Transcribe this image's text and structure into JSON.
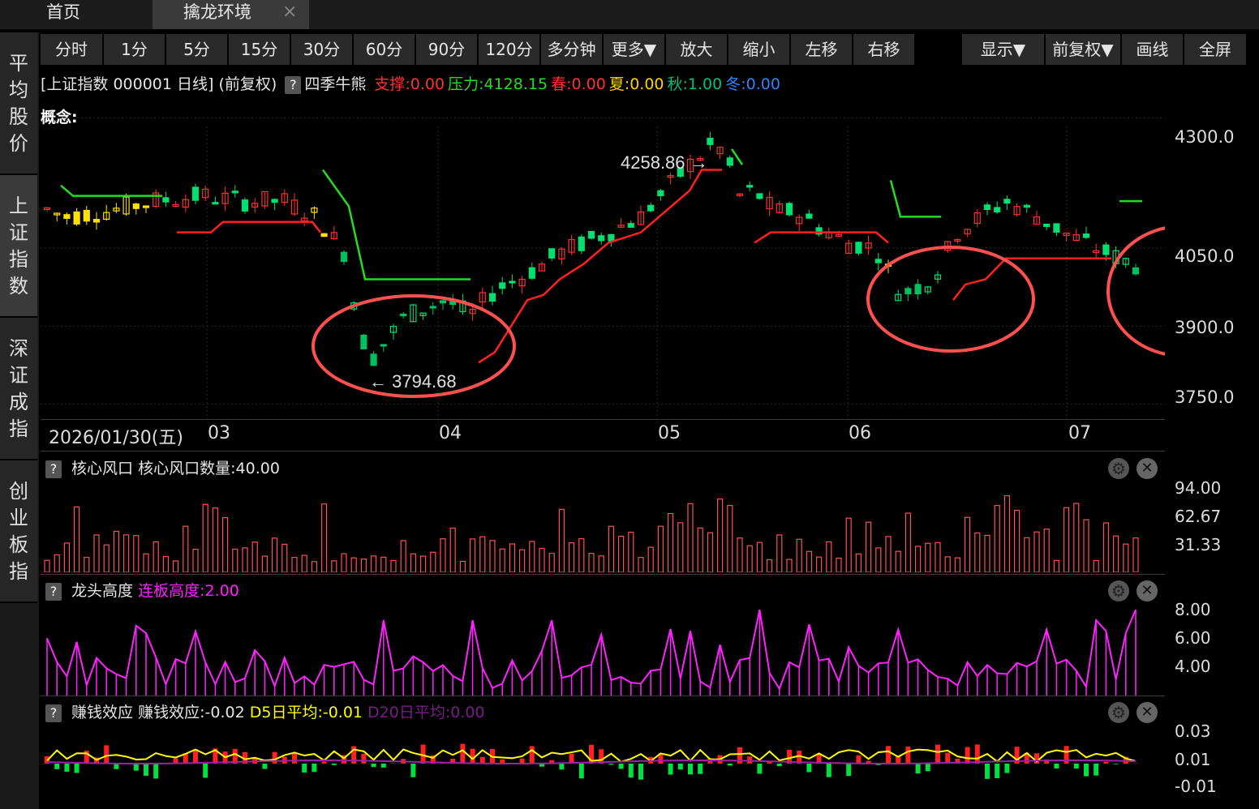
{
  "tabs": {
    "home": "首页",
    "active": "擒龙环境",
    "close": "×"
  },
  "sidebar": [
    {
      "label": "平均股价"
    },
    {
      "label": "上证指数"
    },
    {
      "label": "深证成指"
    },
    {
      "label": "创业板指"
    }
  ],
  "toolbar": [
    "分时",
    "1分",
    "5分",
    "15分",
    "30分",
    "60分",
    "90分",
    "120分",
    "多分钟",
    "更多▼",
    "放大",
    "缩小",
    "左移",
    "右移",
    "显示▼",
    "前复权▼",
    "画线",
    "全屏"
  ],
  "info": {
    "title": "[上证指数 000001 日线] (前复权)",
    "help": "?",
    "indicator": "四季牛熊",
    "support": "支撑:0.00",
    "pressure": "压力:4128.15",
    "spring": "春:0.00",
    "summer": "夏:0.00",
    "autumn": "秋:1.00",
    "winter": "冬:0.00"
  },
  "concept": "概念:",
  "main_chart": {
    "y_ticks": [
      "4300.0",
      "4050.0",
      "3900.0",
      "3750.0"
    ],
    "date_start": "2026/01/30(五)",
    "month_labels": [
      "03",
      "04",
      "05",
      "06",
      "07"
    ],
    "high_label": "4258.86",
    "low_label": "3794.68"
  },
  "panel1": {
    "help": "?",
    "title": "核心风口",
    "value": "核心风口数量:40.00",
    "ticks": [
      "94.00",
      "62.67",
      "31.33"
    ],
    "gear": "⚙",
    "close": "✕"
  },
  "panel2": {
    "help": "?",
    "title": "龙头高度",
    "value": "连板高度:2.00",
    "ticks": [
      "8.00",
      "6.00",
      "4.00"
    ],
    "gear": "⚙",
    "close": "✕"
  },
  "panel3": {
    "help": "?",
    "title": "赚钱效应",
    "value": "赚钱效应:-0.02",
    "d5": "D5日平均:-0.01",
    "d20": "D20日平均:0.00",
    "ticks": [
      "0.03",
      "0.01",
      "-0.01"
    ],
    "gear": "⚙",
    "close": "✕"
  },
  "colors": {
    "up": "#ff3030",
    "down": "#00e070",
    "support": "#ff2020",
    "pressure": "#22dd22",
    "magenta": "#ff22ff",
    "yellow": "#ffff00",
    "circle": "#ff5050"
  },
  "chart_data": {
    "type": "candlestick",
    "x": [
      "2026/01/30",
      "03",
      "04",
      "05",
      "06",
      "07"
    ],
    "ylim": [
      3750,
      4300
    ],
    "annotations": [
      {
        "text": "4258.86",
        "kind": "high"
      },
      {
        "text": "3794.68",
        "kind": "low"
      }
    ],
    "panels": [
      {
        "name": "核心风口数量",
        "type": "bar",
        "ylim": [
          0,
          94
        ]
      },
      {
        "name": "连板高度",
        "type": "line",
        "ylim": [
          2,
          8
        ]
      },
      {
        "name": "赚钱效应",
        "type": "bar",
        "ylim": [
          -0.02,
          0.03
        ]
      }
    ]
  }
}
